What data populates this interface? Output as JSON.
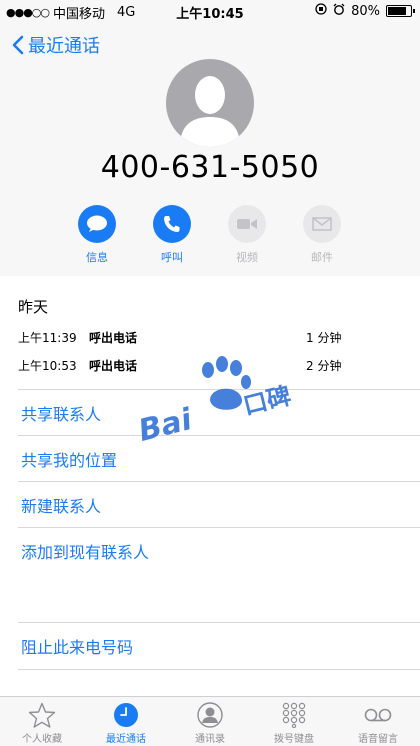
{
  "status_bar": {
    "carrier": "中国移动",
    "network": "4G",
    "time": "上午10:45",
    "battery": "80%",
    "battery_level": 0.8
  },
  "nav": {
    "back_label": "最近通话"
  },
  "contact": {
    "phone": "400-631-5050",
    "avatar_icon": "person-silhouette-icon"
  },
  "actions": [
    {
      "label": "信息",
      "icon": "message-icon",
      "enabled": true
    },
    {
      "label": "呼叫",
      "icon": "phone-icon",
      "enabled": true
    },
    {
      "label": "视频",
      "icon": "video-icon",
      "enabled": false
    },
    {
      "label": "邮件",
      "icon": "mail-icon",
      "enabled": false
    }
  ],
  "recents": {
    "day": "昨天",
    "calls": [
      {
        "time": "上午11:39",
        "type": "呼出电话",
        "duration": "1 分钟"
      },
      {
        "time": "上午10:53",
        "type": "呼出电话",
        "duration": "2 分钟"
      }
    ]
  },
  "menu": [
    "共享联系人",
    "共享我的位置",
    "新建联系人",
    "添加到现有联系人"
  ],
  "block_label": "阻止此来电号码",
  "watermark": {
    "brand": "Bai",
    "suffix": "口碑"
  },
  "tabs": [
    {
      "label": "个人收藏",
      "icon": "star-icon",
      "selected": false
    },
    {
      "label": "最近通话",
      "icon": "clock-icon",
      "selected": true
    },
    {
      "label": "通讯录",
      "icon": "contacts-icon",
      "selected": false
    },
    {
      "label": "拨号键盘",
      "icon": "keypad-icon",
      "selected": false
    },
    {
      "label": "语音留言",
      "icon": "voicemail-icon",
      "selected": false
    }
  ],
  "colors": {
    "accent": "#1a7cf5",
    "disabled": "#b8b8bc",
    "watermark": "#2d6fd6"
  }
}
